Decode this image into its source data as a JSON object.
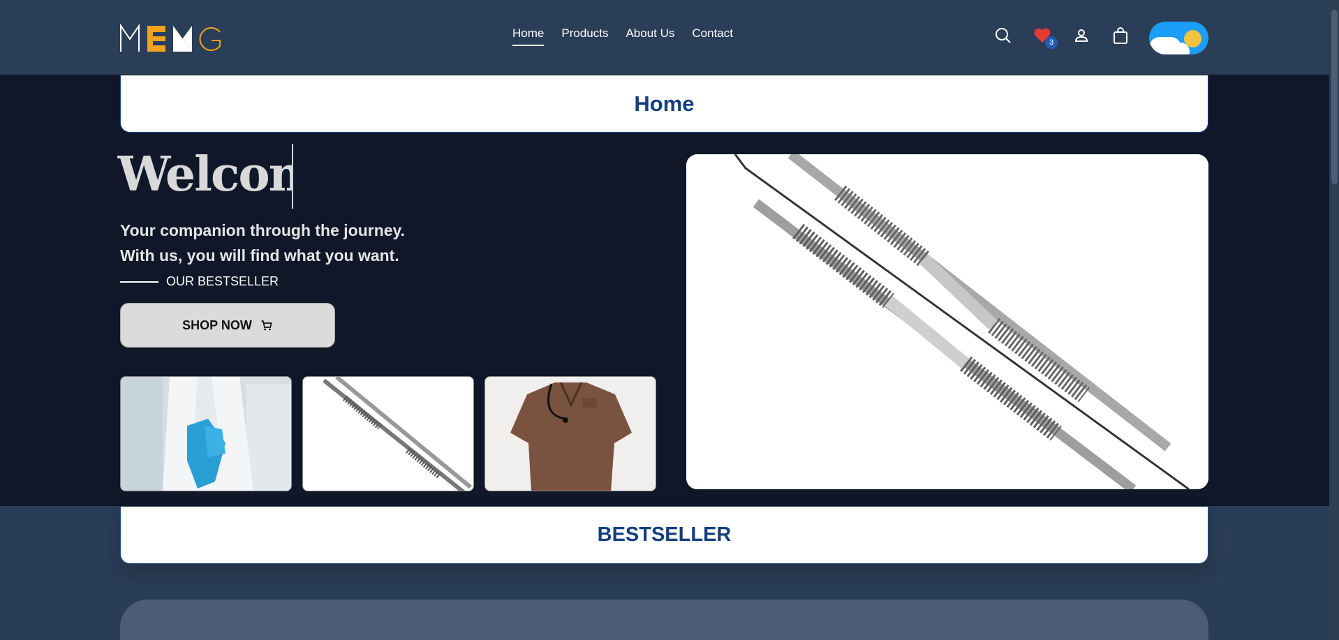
{
  "header": {
    "logo_letters": [
      "M",
      "E",
      "N",
      "G"
    ],
    "nav": [
      {
        "label": "Home",
        "active": true
      },
      {
        "label": "Products",
        "active": false
      },
      {
        "label": "About Us",
        "active": false
      },
      {
        "label": "Contact",
        "active": false
      }
    ],
    "wishlist_count": "3",
    "icons": [
      "search-icon",
      "heart-icon",
      "user-icon",
      "shopping-bag-icon"
    ],
    "theme_toggle": "light"
  },
  "hero": {
    "page_title": "Home",
    "welcome_text": "Welcome",
    "tagline_line1": "Your companion through the journey.",
    "tagline_line2": "With us, you will find what you want.",
    "bestseller_label": "OUR BESTSELLER",
    "shop_button": "SHOP NOW",
    "thumbnails": [
      "gloves-image",
      "dental-instruments-image",
      "scrubs-image"
    ]
  },
  "section": {
    "bestseller_title": "BESTSELLER"
  },
  "colors": {
    "header_bg": "#2b3e58",
    "hero_bg": "#0f1729",
    "accent_yellow": "#f2a31b",
    "title_blue": "#143f7e"
  }
}
